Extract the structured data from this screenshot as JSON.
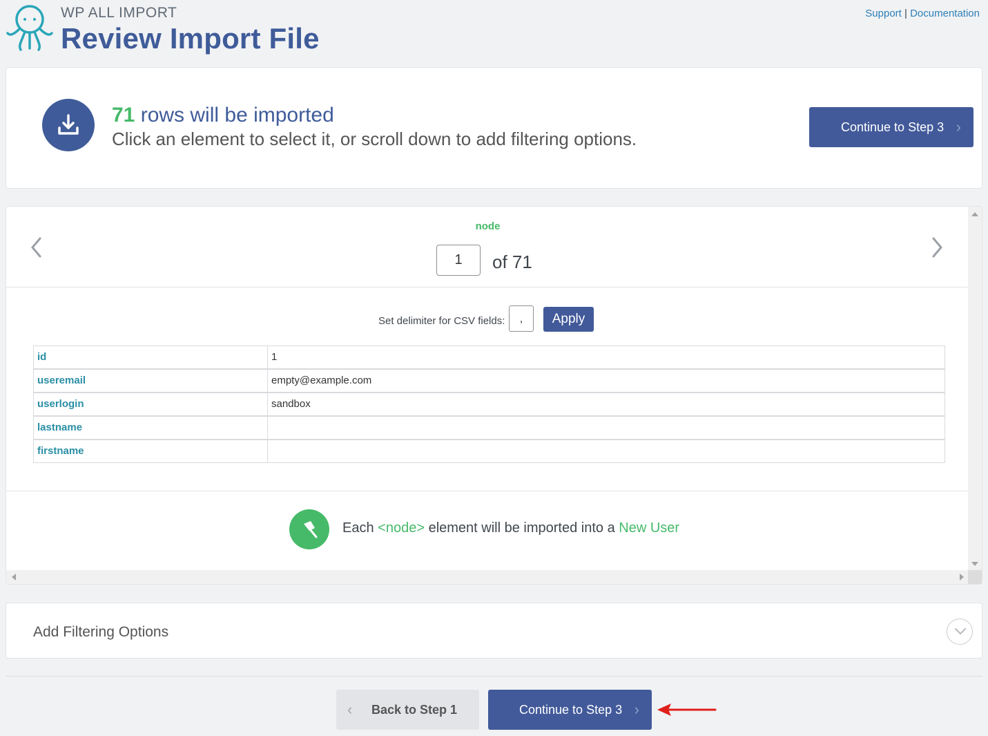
{
  "header": {
    "brand": "WP ALL IMPORT",
    "title": "Review Import File",
    "support_link": "Support",
    "separator": "|",
    "docs_link": "Documentation"
  },
  "summary": {
    "row_count": "71",
    "rows_text": " rows will be imported",
    "instruction": "Click an element to select it, or scroll down to add filtering options.",
    "continue_label": "Continue to Step 3"
  },
  "preview": {
    "node_label": "node",
    "current_page": "1",
    "of_text": "of 71",
    "delimiter_label": "Set delimiter for CSV fields:",
    "delimiter_value": ",",
    "apply_label": "Apply",
    "rows": [
      {
        "key": "id",
        "value": "1"
      },
      {
        "key": "useremail",
        "value": "empty@example.com"
      },
      {
        "key": "userlogin",
        "value": "sandbox"
      },
      {
        "key": "lastname",
        "value": ""
      },
      {
        "key": "firstname",
        "value": ""
      }
    ],
    "note_prefix": "Each ",
    "note_node": "<node>",
    "note_middle": " element will be imported into a ",
    "note_target": "New User"
  },
  "filtering": {
    "title": "Add Filtering Options"
  },
  "footer": {
    "back_label": "Back to Step 1",
    "continue_label": "Continue to Step 3"
  },
  "colors": {
    "primary": "#425a9a",
    "accent_green": "#46ba69",
    "title_blue": "#3f5b99",
    "key_teal": "#2a8fa5",
    "arrow_red": "#e0201b"
  },
  "icons": {
    "logo": "octopus-logo-icon",
    "download": "download-icon",
    "pin": "pin-icon",
    "prev": "chevron-left-icon",
    "next": "chevron-right-icon",
    "expand": "chevron-down-icon",
    "annotation": "red-arrow-icon"
  }
}
